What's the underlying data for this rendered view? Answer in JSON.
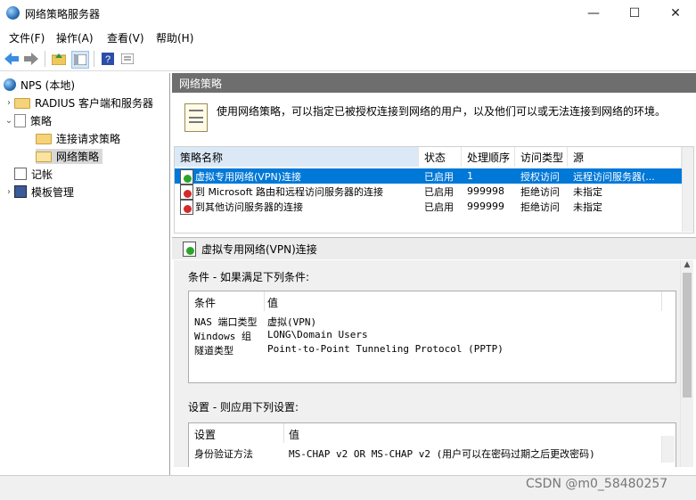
{
  "window": {
    "title": "网络策略服务器",
    "min": "—",
    "max": "☐",
    "close": "✕"
  },
  "menu": [
    "文件(F)",
    "操作(A)",
    "查看(V)",
    "帮助(H)"
  ],
  "tree": {
    "root": "NPS (本地)",
    "radius": "RADIUS 客户端和服务器",
    "policies": "策略",
    "conn_req": "连接请求策略",
    "net_policies": "网络策略",
    "accounting": "记帐",
    "templates": "模板管理"
  },
  "panel": {
    "header": "网络策略",
    "description": "使用网络策略，可以指定已被授权连接到网络的用户，以及他们可以或无法连接到网络的环境。"
  },
  "grid": {
    "columns": [
      "策略名称",
      "状态",
      "处理顺序",
      "访问类型",
      "源"
    ],
    "rows": [
      {
        "name": "虚拟专用网络(VPN)连接",
        "status": "已启用",
        "order": "1",
        "access": "授权访问",
        "source": "远程访问服务器(..."
      },
      {
        "name": "到 Microsoft 路由和远程访问服务器的连接",
        "status": "已启用",
        "order": "999998",
        "access": "拒绝访问",
        "source": "未指定"
      },
      {
        "name": "到其他访问服务器的连接",
        "status": "已启用",
        "order": "999999",
        "access": "拒绝访问",
        "source": "未指定"
      }
    ]
  },
  "detail": {
    "title": "虚拟专用网络(VPN)连接",
    "conditions_label": "条件 - 如果满足下列条件:",
    "conditions_cols": [
      "条件",
      "值"
    ],
    "conditions": [
      {
        "k": "NAS 端口类型",
        "v": "虚拟(VPN)"
      },
      {
        "k": "Windows 组",
        "v": "LONG\\Domain Users"
      },
      {
        "k": "隧道类型",
        "v": "Point-to-Point Tunneling Protocol (PPTP)"
      }
    ],
    "settings_label": "设置 - 则应用下列设置:",
    "settings_cols": [
      "设置",
      "值"
    ],
    "settings": [
      {
        "k": "身份验证方法",
        "v": "MS-CHAP v2 OR MS-CHAP v2 (用户可以在密码过期之后更改密码)"
      }
    ]
  },
  "watermark": "CSDN @m0_58480257"
}
